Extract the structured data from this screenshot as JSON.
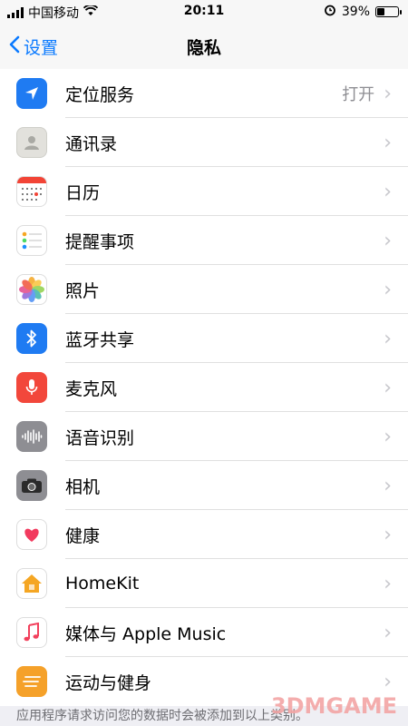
{
  "status_bar": {
    "carrier": "中国移动",
    "time": "20:11",
    "battery_pct": "39%",
    "battery_level": 0.39
  },
  "nav": {
    "back_label": "设置",
    "title": "隐私"
  },
  "rows": [
    {
      "label": "定位服务",
      "value": "打开",
      "icon": "location-icon"
    },
    {
      "label": "通讯录",
      "value": "",
      "icon": "contacts-icon"
    },
    {
      "label": "日历",
      "value": "",
      "icon": "calendar-icon"
    },
    {
      "label": "提醒事项",
      "value": "",
      "icon": "reminders-icon"
    },
    {
      "label": "照片",
      "value": "",
      "icon": "photos-icon"
    },
    {
      "label": "蓝牙共享",
      "value": "",
      "icon": "bluetooth-icon"
    },
    {
      "label": "麦克风",
      "value": "",
      "icon": "microphone-icon"
    },
    {
      "label": "语音识别",
      "value": "",
      "icon": "speech-icon"
    },
    {
      "label": "相机",
      "value": "",
      "icon": "camera-icon"
    },
    {
      "label": "健康",
      "value": "",
      "icon": "health-icon"
    },
    {
      "label": "HomeKit",
      "value": "",
      "icon": "homekit-icon"
    },
    {
      "label": "媒体与 Apple Music",
      "value": "",
      "icon": "music-icon"
    },
    {
      "label": "运动与健身",
      "value": "",
      "icon": "fitness-icon"
    }
  ],
  "footer_text": "应用程序请求访问您的数据时会被添加到以上类别。",
  "watermark": "3DMGAME"
}
